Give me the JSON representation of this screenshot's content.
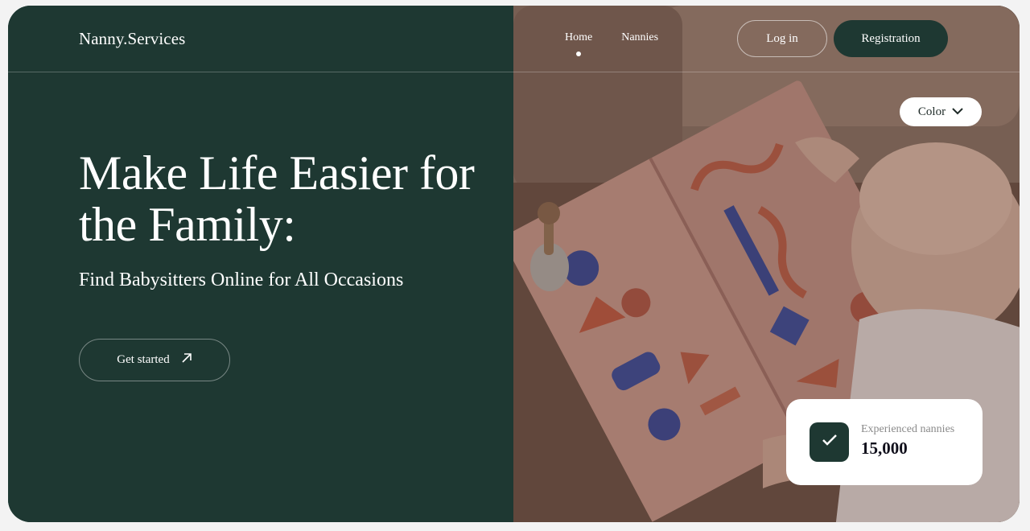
{
  "header": {
    "logo": "Nanny.Services",
    "nav": [
      {
        "label": "Home",
        "active": true
      },
      {
        "label": "Nannies",
        "active": false
      }
    ],
    "login_label": "Log in",
    "registration_label": "Registration"
  },
  "hero": {
    "headline": "Make Life Easier for the Family:",
    "subheadline": "Find Babysitters Online for All Occasions",
    "cta_label": "Get started",
    "cta_icon": "arrow-up-right-icon"
  },
  "color_select": {
    "label": "Color",
    "icon": "chevron-down-icon"
  },
  "stat": {
    "label": "Experienced nannies",
    "value": "15,000",
    "icon": "check-icon"
  },
  "colors": {
    "primary": "#1e3832",
    "white": "#ffffff",
    "card_text": "#11101c",
    "muted": "#8a8a8a"
  }
}
